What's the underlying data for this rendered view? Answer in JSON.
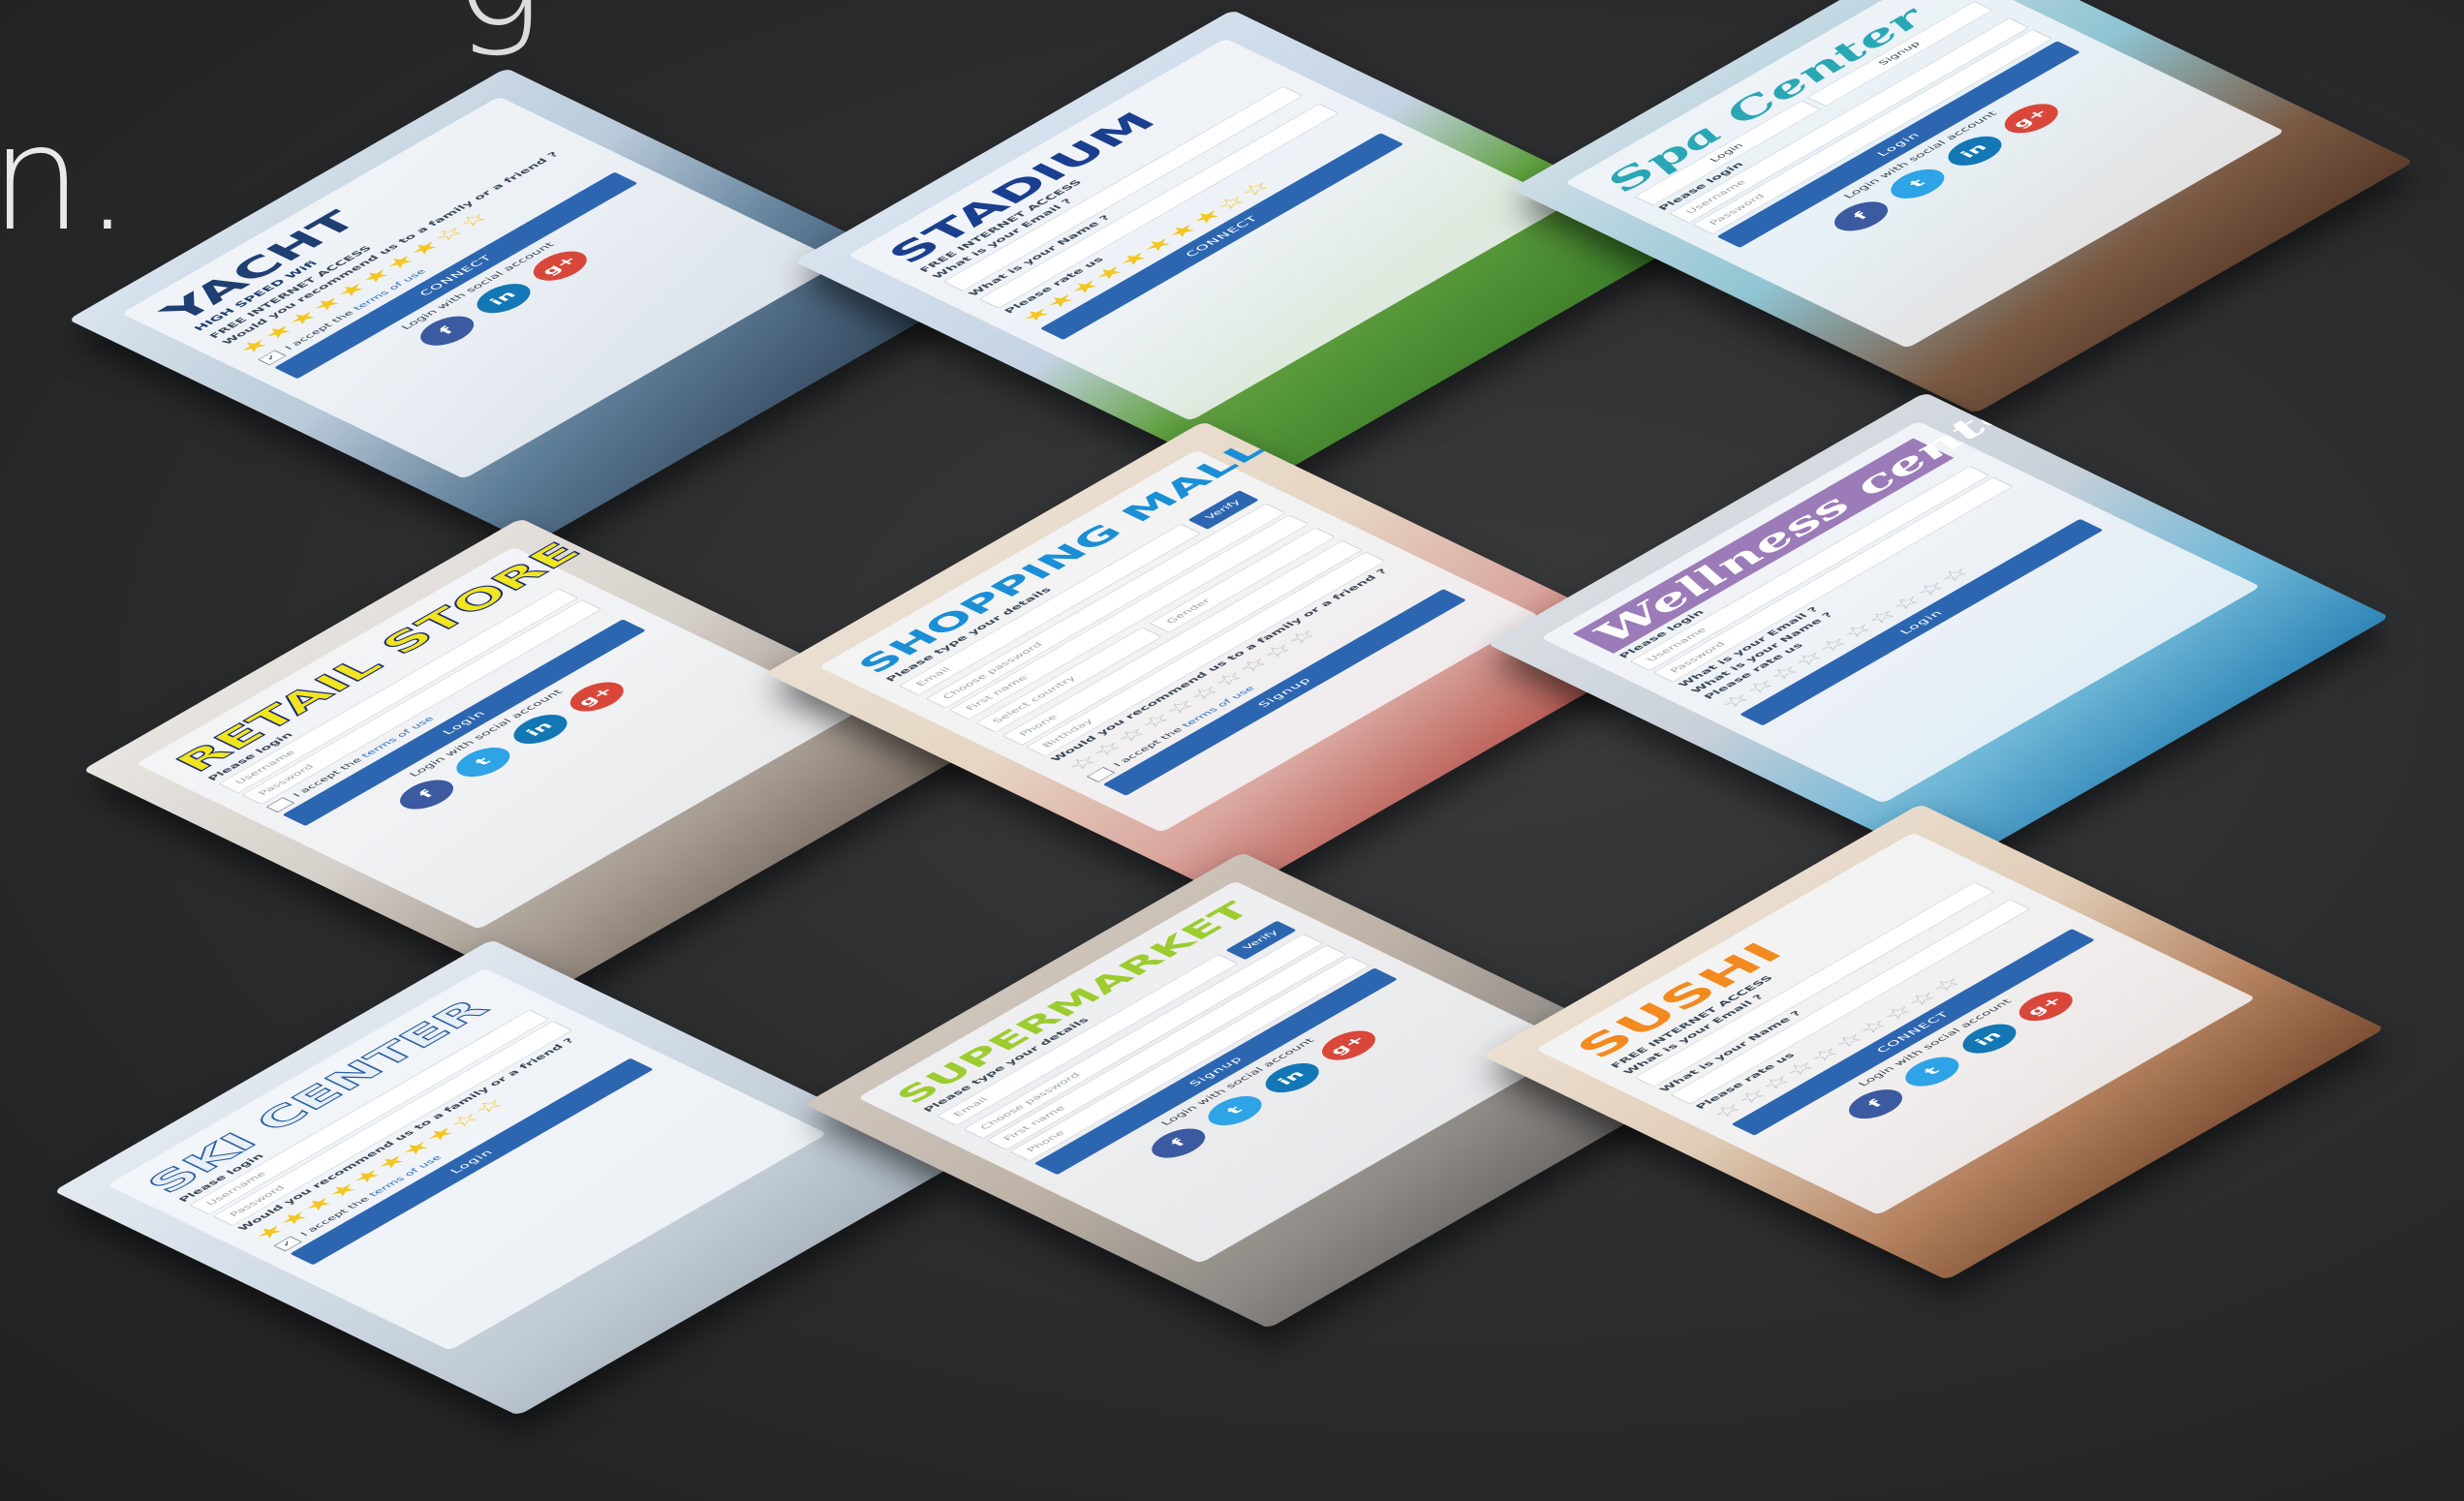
{
  "headline": {
    "fragment_top": "g",
    "fragment": "n."
  },
  "icons": {
    "fb": "f",
    "tw": "t",
    "li": "in",
    "gp": "g+"
  },
  "cards": {
    "yacht": {
      "logo": "YACHT",
      "logo_sub": "HIGH SPEED Wifi",
      "free_access": "FREE INTERNET ACCESS",
      "recommend": "Would you recommend us to a family or a friend ?",
      "stars": "★★★★★★★★☆☆",
      "check_mark": "✓",
      "terms_prefix": "I accept the",
      "terms_link": "terms of use",
      "button": "CONNECT",
      "social": "Login with social account"
    },
    "stadium": {
      "logo": "STADIUM",
      "free_access": "FREE INTERNET ACCESS",
      "email_q": "What is your Email ?",
      "name_q": "What is your Name ?",
      "rate": "Please rate us",
      "stars": "★★★★★★★★☆☆",
      "button": "CONNECT"
    },
    "spa": {
      "logo": "Spa Center",
      "tab_login": "Login",
      "tab_signup": "Signup",
      "please_login": "Please login",
      "username": "Username",
      "password": "Password",
      "button": "Login",
      "social": "Login with social account"
    },
    "retail": {
      "logo": "RETAIL STORE",
      "please_login": "Please login",
      "username": "Username",
      "password": "Password",
      "terms_prefix": "I accept the",
      "terms_link": "terms of use",
      "button": "Login",
      "social": "Login with social account"
    },
    "mall": {
      "logo": "SHOPPING MALL",
      "please_type": "Please type your details",
      "email": "Email",
      "verify": "Verify",
      "choose_password": "Choose password",
      "first_name": "First name",
      "country": "Select country",
      "gender": "Gender",
      "phone": "Phone",
      "birthday": "Birthday",
      "recommend": "Would you recommend us to a family or a friend ?",
      "stars": "☆☆☆☆☆☆☆☆☆☆",
      "terms_prefix": "I accept the",
      "terms_link": "terms of use",
      "button": "Signup"
    },
    "wellness": {
      "logo": "Wellness center",
      "please_login": "Please login",
      "username": "Username",
      "password": "Password",
      "email_q": "What is your Email ?",
      "name_q": "What is your Name ?",
      "rate": "Please rate us",
      "stars": "☆☆☆☆☆☆☆☆☆☆",
      "button": "Login"
    },
    "ski": {
      "logo": "SKI CENTER",
      "please_login": "Please login",
      "username": "Username",
      "password": "Password",
      "recommend": "Would you recommend us to a family or a friend ?",
      "stars": "★★★★★★★★☆☆",
      "check_mark": "✓",
      "terms_prefix": "I accept the",
      "terms_link": "terms of use",
      "button": "Login"
    },
    "supermarket": {
      "logo": "SUPERMARKET",
      "please_type": "Please type your details",
      "email": "Email",
      "verify": "Verify",
      "choose_password": "Choose password",
      "first_name": "First name",
      "phone": "Phone",
      "button": "Signup",
      "social": "Login with social account"
    },
    "sushi": {
      "logo": "SUSHI",
      "free_access": "FREE INTERNET ACCESS",
      "email_q": "What is your Email ?",
      "name_q": "What is your Name ?",
      "rate": "Please rate us",
      "stars": "☆☆☆☆☆☆☆☆☆☆",
      "button": "CONNECT",
      "social": "Login with social account"
    }
  }
}
